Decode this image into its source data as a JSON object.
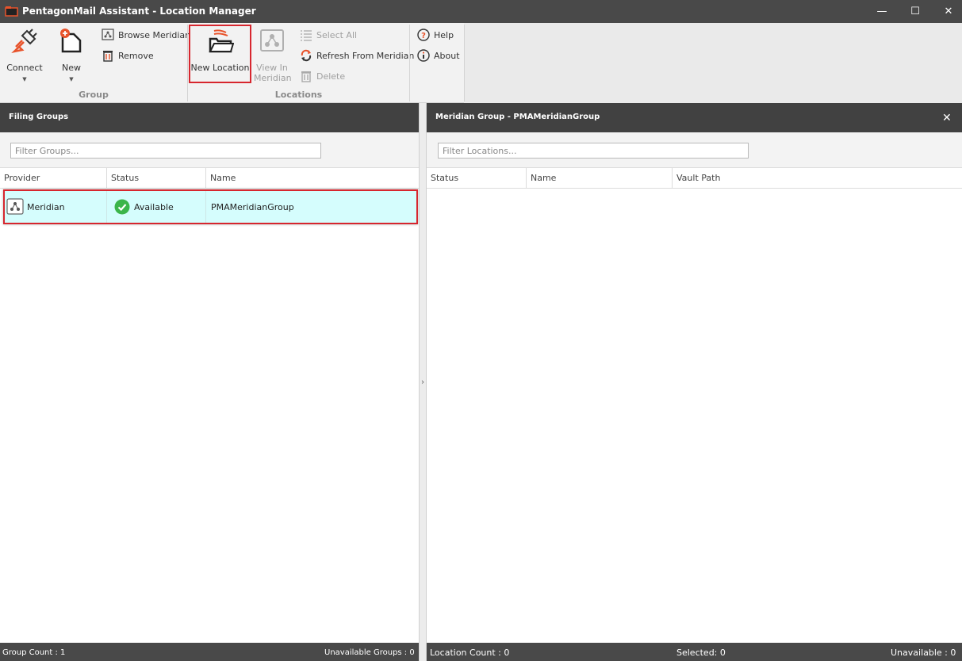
{
  "window": {
    "title": "PentagonMail Assistant - Location Manager",
    "minimize": "—",
    "maximize": "☐",
    "close": "✕"
  },
  "ribbon": {
    "group": {
      "label": "Group",
      "connect": "Connect",
      "new": "New",
      "browse_meridian": "Browse Meridian",
      "remove": "Remove"
    },
    "locations": {
      "label": "Locations",
      "new_location": "New Location",
      "view_in_meridian_line1": "View In",
      "view_in_meridian_line2": "Meridian",
      "select_all": "Select All",
      "refresh_from_meridian": "Refresh From Meridian",
      "delete": "Delete"
    },
    "help": {
      "help": "Help",
      "about": "About"
    },
    "caret": "▼"
  },
  "left_panel": {
    "title": "Filing Groups",
    "filter_placeholder": "Filter Groups...",
    "columns": [
      "Provider",
      "Status",
      "Name"
    ],
    "rows": [
      {
        "provider": "Meridian",
        "status": "Available",
        "name": "PMAMeridianGroup"
      }
    ],
    "status": {
      "group_count": "Group Count : 1",
      "unavailable_groups": "Unavailable Groups : 0"
    }
  },
  "right_panel": {
    "title": "Meridian Group - PMAMeridianGroup",
    "close": "✕",
    "filter_placeholder": "Filter Locations...",
    "columns": [
      "Status",
      "Name",
      "Vault Path"
    ],
    "status": {
      "location_count": "Location Count : 0",
      "selected": "Selected: 0",
      "unavailable": "Unavailable : 0"
    }
  },
  "splitter_arrow": "›",
  "colors": {
    "titlebar": "#494949",
    "highlight_border": "#d7262e",
    "selected_row": "#d5fdfd",
    "accent_orange": "#e8532b",
    "available_green": "#3bb54a"
  }
}
